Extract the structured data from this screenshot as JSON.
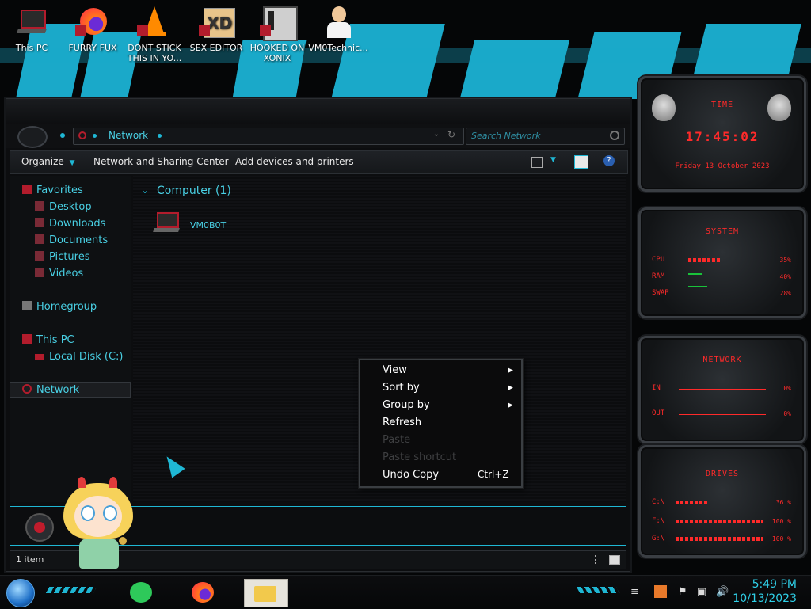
{
  "desktop": {
    "icons": [
      {
        "label": "This PC",
        "icon": "computer-icon"
      },
      {
        "label": "FURRY FUX",
        "icon": "firefox-icon"
      },
      {
        "label": "DONT STICK THIS IN YO...",
        "icon": "vlc-cone-icon"
      },
      {
        "label": "SEX EDITOR",
        "icon": "xd-icon"
      },
      {
        "label": "HOOKED ON XONIX",
        "icon": "game-icon"
      },
      {
        "label": "VM0Technic...",
        "icon": "user-icon"
      }
    ]
  },
  "explorer": {
    "address": {
      "path": "Network",
      "search_placeholder": "Search Network"
    },
    "toolbar": {
      "organize": "Organize",
      "network_sharing": "Network and Sharing Center",
      "add_devices": "Add devices and printers"
    },
    "nav": {
      "favorites": "Favorites",
      "favorites_items": [
        "Desktop",
        "Downloads",
        "Documents",
        "Pictures",
        "Videos"
      ],
      "homegroup": "Homegroup",
      "this_pc": "This PC",
      "this_pc_items": [
        "Local Disk (C:)"
      ],
      "network": "Network"
    },
    "content": {
      "group_header": "Computer (1)",
      "items": [
        "VM0B0T"
      ]
    },
    "status": {
      "count": "1 item"
    }
  },
  "context_menu": {
    "items": [
      {
        "label": "View",
        "submenu": true,
        "enabled": true,
        "shortcut": ""
      },
      {
        "label": "Sort by",
        "submenu": true,
        "enabled": true,
        "shortcut": ""
      },
      {
        "label": "Group by",
        "submenu": true,
        "enabled": true,
        "shortcut": ""
      },
      {
        "label": "Refresh",
        "submenu": false,
        "enabled": true,
        "shortcut": ""
      },
      {
        "label": "Paste",
        "submenu": false,
        "enabled": false,
        "shortcut": ""
      },
      {
        "label": "Paste shortcut",
        "submenu": false,
        "enabled": false,
        "shortcut": ""
      },
      {
        "label": "Undo Copy",
        "submenu": false,
        "enabled": true,
        "shortcut": "Ctrl+Z"
      }
    ]
  },
  "gadgets": {
    "time": {
      "title": "TIME",
      "clock": "17:45:02",
      "date": "Friday 13 October 2023"
    },
    "system": {
      "title": "SYSTEM",
      "rows": [
        {
          "label": "CPU",
          "value": "35%",
          "level": 0.35
        },
        {
          "label": "RAM",
          "value": "40%",
          "level": 0.4
        },
        {
          "label": "SWAP",
          "value": "28%",
          "level": 0.28
        }
      ]
    },
    "network": {
      "title": "NETWORK",
      "rows": [
        {
          "label": "IN",
          "value": "0%"
        },
        {
          "label": "OUT",
          "value": "0%"
        }
      ]
    },
    "drives": {
      "title": "DRIVES",
      "rows": [
        {
          "label": "C:\\",
          "value": "36 %",
          "level": 0.36
        },
        {
          "label": "F:\\",
          "value": "100 %",
          "level": 1.0
        },
        {
          "label": "G:\\",
          "value": "100 %",
          "level": 1.0
        }
      ]
    }
  },
  "taskbar": {
    "time": "5:49 PM",
    "date": "10/13/2023"
  },
  "colors": {
    "accent": "#1fb7d4",
    "gadget_red": "#ff2a2a",
    "nav_text": "#49d0e4"
  }
}
